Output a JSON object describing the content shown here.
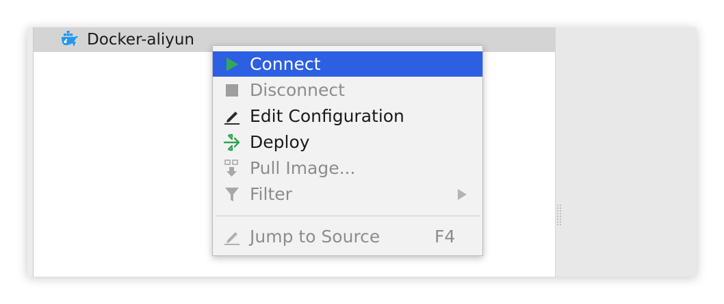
{
  "tree": {
    "node_label": "Docker-aliyun",
    "node_icon": "docker-whale-icon"
  },
  "context_menu": {
    "items": [
      {
        "label": "Connect",
        "icon": "play-icon",
        "state": "selected",
        "color": "#34a853"
      },
      {
        "label": "Disconnect",
        "icon": "stop-icon",
        "state": "disabled"
      },
      {
        "label": "Edit Configuration",
        "icon": "pencil-icon",
        "state": "enabled"
      },
      {
        "label": "Deploy",
        "icon": "deploy-icon",
        "state": "enabled",
        "color": "#2ea44f"
      },
      {
        "label": "Pull Image...",
        "icon": "pull-image-icon",
        "state": "disabled"
      },
      {
        "label": "Filter",
        "icon": "filter-icon",
        "state": "disabled",
        "submenu": true
      },
      {
        "label": "Jump to Source",
        "icon": "pencil-icon",
        "state": "disabled",
        "shortcut": "F4"
      }
    ]
  },
  "colors": {
    "selection": "#2d5fe3",
    "docker_blue": "#2496ed"
  }
}
